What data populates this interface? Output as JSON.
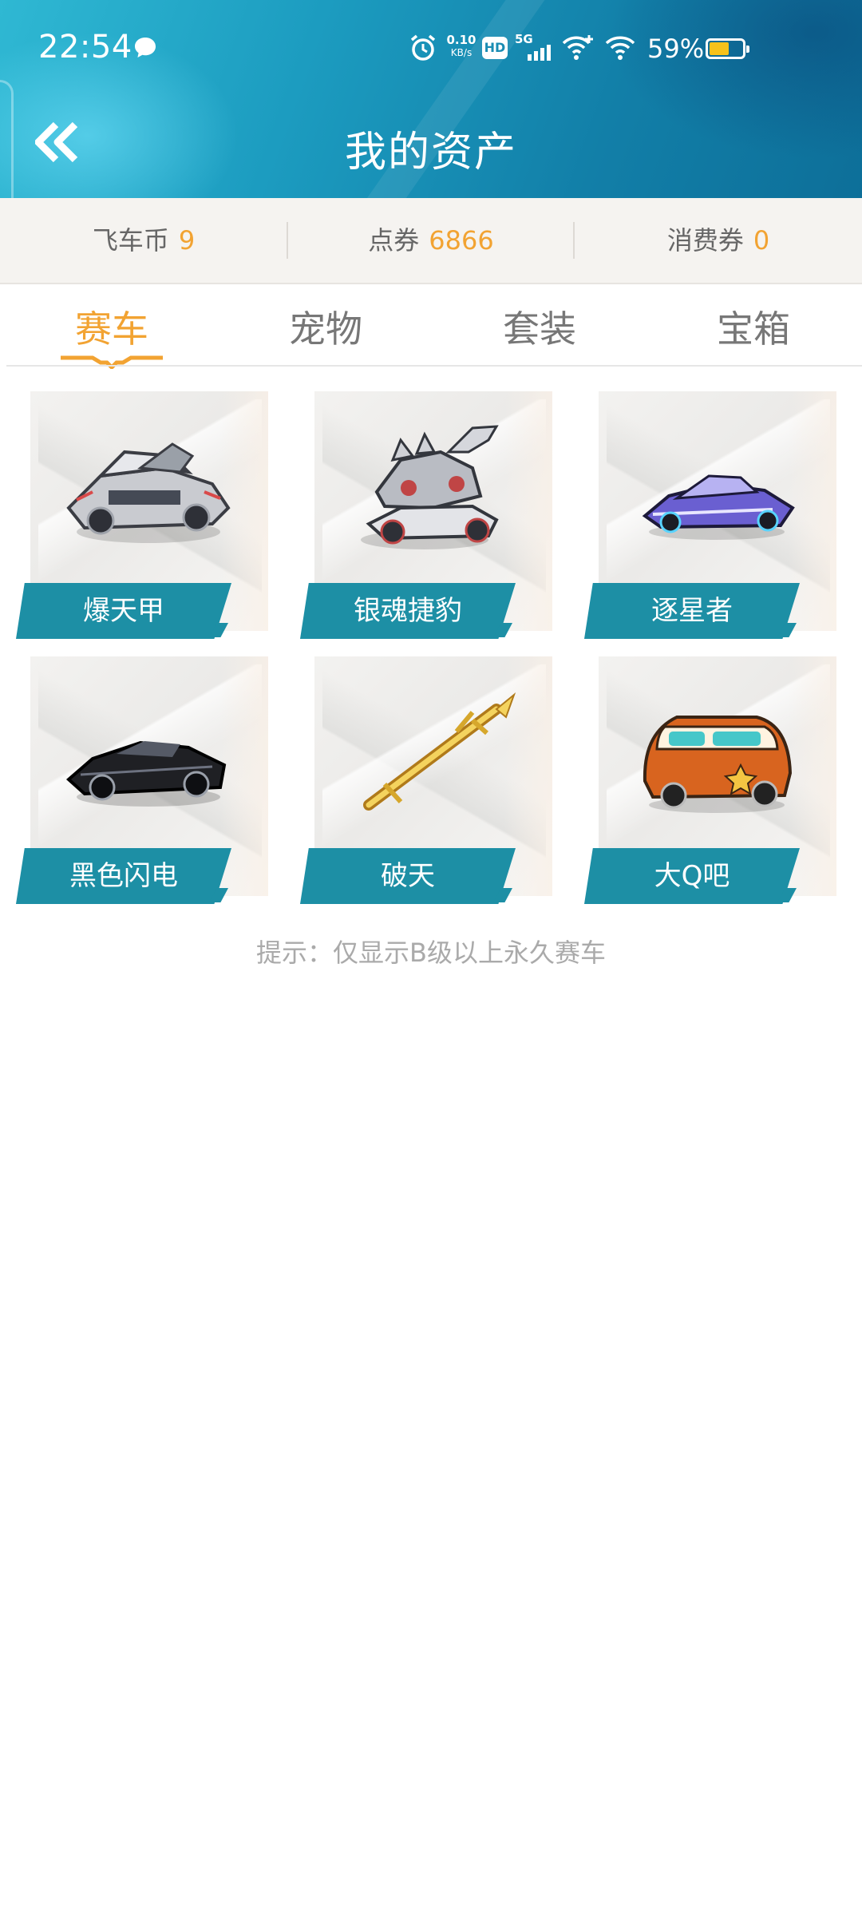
{
  "status_bar": {
    "time": "22:54",
    "net_speed_value": "0.10",
    "net_speed_unit": "KB/s",
    "hd_label": "HD",
    "signal_label": "5G",
    "battery_percent_text": "59%",
    "battery_level": 0.59,
    "battery_color": "#f7c21b",
    "icons": [
      "chat-icon",
      "alarm-icon",
      "hd-icon",
      "signal-5g-icon",
      "wifi-plus-icon",
      "wifi-icon",
      "battery-icon"
    ]
  },
  "header": {
    "title": "我的资产",
    "back_icon": "double-chevron-left-icon"
  },
  "balances": [
    {
      "label": "飞车币",
      "value": "9"
    },
    {
      "label": "点券",
      "value": "6866"
    },
    {
      "label": "消费券",
      "value": "0"
    }
  ],
  "tabs": [
    {
      "label": "赛车",
      "active": true
    },
    {
      "label": "宠物",
      "active": false
    },
    {
      "label": "套装",
      "active": false
    },
    {
      "label": "宝箱",
      "active": false
    }
  ],
  "cars": [
    {
      "name": "爆天甲",
      "icon": "armored-car-icon"
    },
    {
      "name": "银魂捷豹",
      "icon": "mech-car-icon"
    },
    {
      "name": "逐星者",
      "icon": "purple-racer-icon"
    },
    {
      "name": "黑色闪电",
      "icon": "black-sports-car-icon"
    },
    {
      "name": "破天",
      "icon": "golden-sword-icon"
    },
    {
      "name": "大Q吧",
      "icon": "orange-van-icon"
    }
  ],
  "hint": "提示：仅显示B级以上永久赛车",
  "colors": {
    "accent_orange": "#f2a332",
    "label_teal": "#1d8fa5",
    "header_blue": "#1c9cc0"
  }
}
